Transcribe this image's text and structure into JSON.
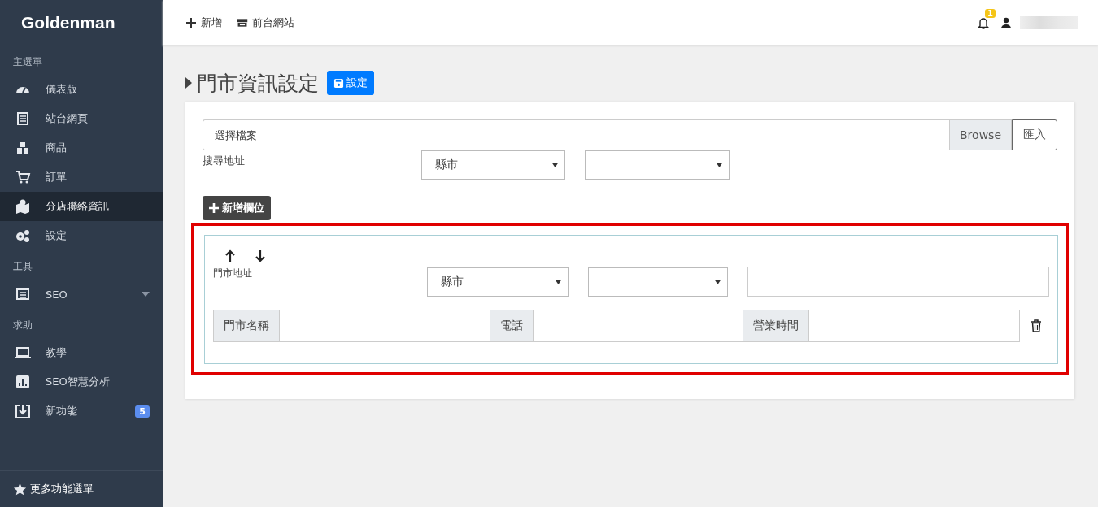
{
  "sidebar": {
    "brand": "Goldenman",
    "items": [
      {
        "kind": "header",
        "label": "主選單"
      },
      {
        "kind": "item",
        "label": "儀表版",
        "selected": false
      },
      {
        "kind": "item",
        "label": "站台網頁",
        "selected": false
      },
      {
        "kind": "item",
        "label": "商品",
        "selected": false
      },
      {
        "kind": "item",
        "label": "訂單",
        "selected": false
      },
      {
        "kind": "item",
        "label": "分店聯絡資訊",
        "selected": true
      },
      {
        "kind": "item",
        "label": "設定",
        "selected": false
      },
      {
        "kind": "header",
        "label": "工具"
      },
      {
        "kind": "item",
        "label": "SEO",
        "selected": false,
        "expandable": true
      },
      {
        "kind": "header",
        "label": "求助"
      },
      {
        "kind": "item",
        "label": "教學",
        "selected": false
      },
      {
        "kind": "item",
        "label": "SEO智慧分析",
        "selected": false
      },
      {
        "kind": "item",
        "label": "新功能",
        "selected": false,
        "badge": "5"
      }
    ],
    "footer": "更多功能選單"
  },
  "topbar": {
    "actions": [
      "新增",
      "前台網站"
    ],
    "notification_count": "1"
  },
  "page": {
    "title": "門市資訊設定",
    "save_button": "設定",
    "file": {
      "placeholder": "選擇檔案",
      "browse": "Browse",
      "import_button": "匯入"
    },
    "search": {
      "label": "搜尋地址",
      "county": "縣市"
    },
    "add_button": "新增欄位",
    "entry": {
      "highlighted": true,
      "address_label": "門市地址",
      "county": "縣市",
      "name_label": "門市名稱",
      "phone_label": "電話",
      "hours_label": "營業時間"
    }
  }
}
